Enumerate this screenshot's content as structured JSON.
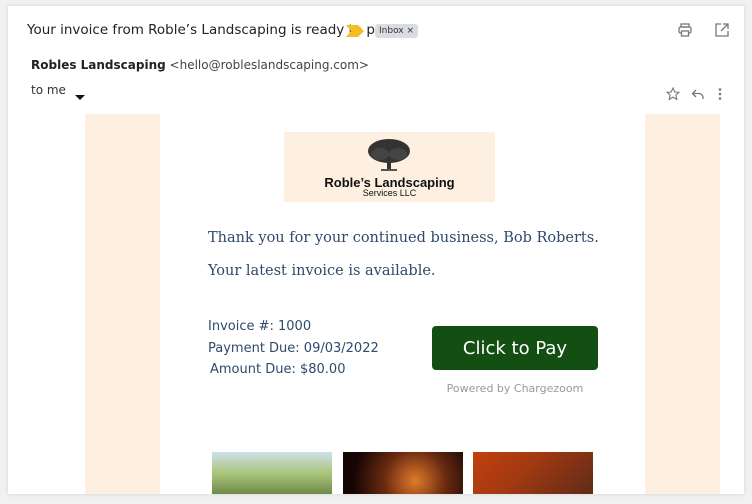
{
  "header": {
    "subject": "Your invoice from Roble’s Landscaping is ready to pay",
    "label_chip": "Inbox ×",
    "sender_name": "Robles Landscaping",
    "sender_email": "<hello@robleslandscaping.com>",
    "recipient": "to me",
    "colors": {
      "label_arrow": "#f5bd1f"
    }
  },
  "toolbar": {
    "icons": [
      "print-icon",
      "open-in-new-window-icon",
      "star-icon",
      "reply-icon",
      "more-vert-icon"
    ]
  },
  "email_body": {
    "logo": {
      "name": "Roble’s Landscaping",
      "subtitle": "Services LLC"
    },
    "greeting": "Thank you for your continued business, Bob Roberts.",
    "intro": "Your latest invoice is available.",
    "invoice_number": "Invoice #: 1000",
    "payment_due": "Payment Due: 09/03/2022",
    "amount_due": "Amount Due: $80.00",
    "pay_button": "Click to Pay",
    "powered_by": "Powered by Chargezoom",
    "colors": {
      "accent_peach": "#fdf0e1",
      "button_green": "#134f13",
      "text_navy": "#2f4a6b"
    },
    "photos": [
      "palm-tree-trimming-photo",
      "holiday-lights-bokeh-photo",
      "holiday-lights-house-photo"
    ]
  }
}
